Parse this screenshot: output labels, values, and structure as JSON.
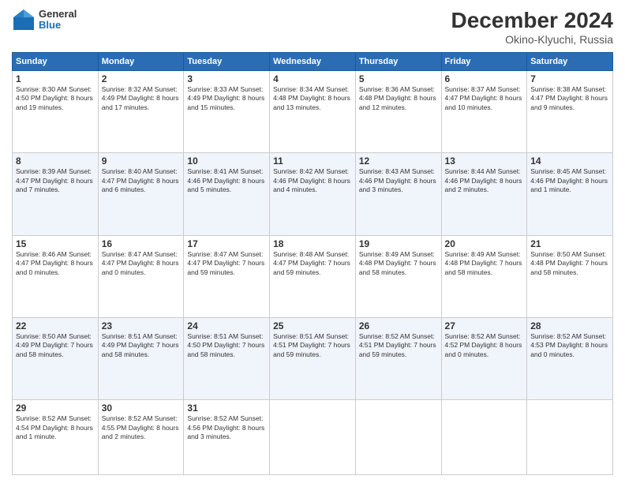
{
  "header": {
    "logo_line1": "General",
    "logo_line2": "Blue",
    "month_title": "December 2024",
    "subtitle": "Okino-Klyuchi, Russia"
  },
  "calendar": {
    "headers": [
      "Sunday",
      "Monday",
      "Tuesday",
      "Wednesday",
      "Thursday",
      "Friday",
      "Saturday"
    ],
    "weeks": [
      [
        {
          "day": "1",
          "info": "Sunrise: 8:30 AM\nSunset: 4:50 PM\nDaylight: 8 hours\nand 19 minutes."
        },
        {
          "day": "2",
          "info": "Sunrise: 8:32 AM\nSunset: 4:49 PM\nDaylight: 8 hours\nand 17 minutes."
        },
        {
          "day": "3",
          "info": "Sunrise: 8:33 AM\nSunset: 4:49 PM\nDaylight: 8 hours\nand 15 minutes."
        },
        {
          "day": "4",
          "info": "Sunrise: 8:34 AM\nSunset: 4:48 PM\nDaylight: 8 hours\nand 13 minutes."
        },
        {
          "day": "5",
          "info": "Sunrise: 8:36 AM\nSunset: 4:48 PM\nDaylight: 8 hours\nand 12 minutes."
        },
        {
          "day": "6",
          "info": "Sunrise: 8:37 AM\nSunset: 4:47 PM\nDaylight: 8 hours\nand 10 minutes."
        },
        {
          "day": "7",
          "info": "Sunrise: 8:38 AM\nSunset: 4:47 PM\nDaylight: 8 hours\nand 9 minutes."
        }
      ],
      [
        {
          "day": "8",
          "info": "Sunrise: 8:39 AM\nSunset: 4:47 PM\nDaylight: 8 hours\nand 7 minutes."
        },
        {
          "day": "9",
          "info": "Sunrise: 8:40 AM\nSunset: 4:47 PM\nDaylight: 8 hours\nand 6 minutes."
        },
        {
          "day": "10",
          "info": "Sunrise: 8:41 AM\nSunset: 4:46 PM\nDaylight: 8 hours\nand 5 minutes."
        },
        {
          "day": "11",
          "info": "Sunrise: 8:42 AM\nSunset: 4:46 PM\nDaylight: 8 hours\nand 4 minutes."
        },
        {
          "day": "12",
          "info": "Sunrise: 8:43 AM\nSunset: 4:46 PM\nDaylight: 8 hours\nand 3 minutes."
        },
        {
          "day": "13",
          "info": "Sunrise: 8:44 AM\nSunset: 4:46 PM\nDaylight: 8 hours\nand 2 minutes."
        },
        {
          "day": "14",
          "info": "Sunrise: 8:45 AM\nSunset: 4:46 PM\nDaylight: 8 hours\nand 1 minute."
        }
      ],
      [
        {
          "day": "15",
          "info": "Sunrise: 8:46 AM\nSunset: 4:47 PM\nDaylight: 8 hours\nand 0 minutes."
        },
        {
          "day": "16",
          "info": "Sunrise: 8:47 AM\nSunset: 4:47 PM\nDaylight: 8 hours\nand 0 minutes."
        },
        {
          "day": "17",
          "info": "Sunrise: 8:47 AM\nSunset: 4:47 PM\nDaylight: 7 hours\nand 59 minutes."
        },
        {
          "day": "18",
          "info": "Sunrise: 8:48 AM\nSunset: 4:47 PM\nDaylight: 7 hours\nand 59 minutes."
        },
        {
          "day": "19",
          "info": "Sunrise: 8:49 AM\nSunset: 4:48 PM\nDaylight: 7 hours\nand 58 minutes."
        },
        {
          "day": "20",
          "info": "Sunrise: 8:49 AM\nSunset: 4:48 PM\nDaylight: 7 hours\nand 58 minutes."
        },
        {
          "day": "21",
          "info": "Sunrise: 8:50 AM\nSunset: 4:48 PM\nDaylight: 7 hours\nand 58 minutes."
        }
      ],
      [
        {
          "day": "22",
          "info": "Sunrise: 8:50 AM\nSunset: 4:49 PM\nDaylight: 7 hours\nand 58 minutes."
        },
        {
          "day": "23",
          "info": "Sunrise: 8:51 AM\nSunset: 4:49 PM\nDaylight: 7 hours\nand 58 minutes."
        },
        {
          "day": "24",
          "info": "Sunrise: 8:51 AM\nSunset: 4:50 PM\nDaylight: 7 hours\nand 58 minutes."
        },
        {
          "day": "25",
          "info": "Sunrise: 8:51 AM\nSunset: 4:51 PM\nDaylight: 7 hours\nand 59 minutes."
        },
        {
          "day": "26",
          "info": "Sunrise: 8:52 AM\nSunset: 4:51 PM\nDaylight: 7 hours\nand 59 minutes."
        },
        {
          "day": "27",
          "info": "Sunrise: 8:52 AM\nSunset: 4:52 PM\nDaylight: 8 hours\nand 0 minutes."
        },
        {
          "day": "28",
          "info": "Sunrise: 8:52 AM\nSunset: 4:53 PM\nDaylight: 8 hours\nand 0 minutes."
        }
      ],
      [
        {
          "day": "29",
          "info": "Sunrise: 8:52 AM\nSunset: 4:54 PM\nDaylight: 8 hours\nand 1 minute."
        },
        {
          "day": "30",
          "info": "Sunrise: 8:52 AM\nSunset: 4:55 PM\nDaylight: 8 hours\nand 2 minutes."
        },
        {
          "day": "31",
          "info": "Sunrise: 8:52 AM\nSunset: 4:56 PM\nDaylight: 8 hours\nand 3 minutes."
        },
        {
          "day": "",
          "info": ""
        },
        {
          "day": "",
          "info": ""
        },
        {
          "day": "",
          "info": ""
        },
        {
          "day": "",
          "info": ""
        }
      ]
    ]
  }
}
